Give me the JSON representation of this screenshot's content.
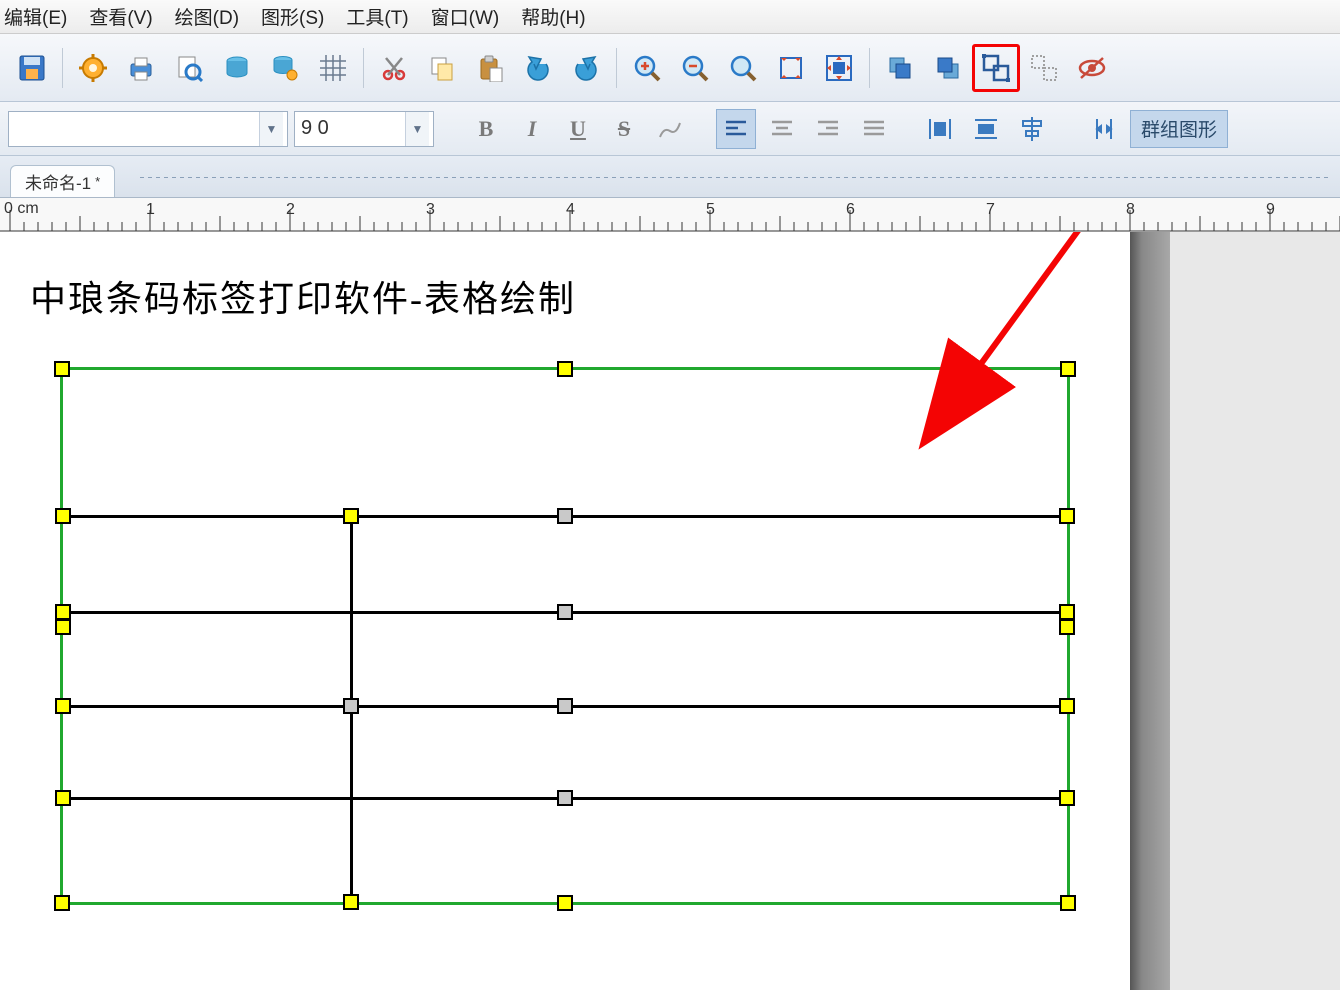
{
  "menu": {
    "edit": "编辑(E)",
    "view": "查看(V)",
    "draw": "绘图(D)",
    "shape": "图形(S)",
    "tool": "工具(T)",
    "window": "窗口(W)",
    "help": "帮助(H)"
  },
  "toolbar": {
    "font_size": "9 0",
    "group_label": "群组图形"
  },
  "tab": {
    "name": "未命名-1",
    "modified": "*"
  },
  "ruler": {
    "unit": "0 cm",
    "marks": [
      "1",
      "2",
      "3",
      "4",
      "5",
      "6",
      "7",
      "8",
      "9"
    ]
  },
  "canvas": {
    "title": "中琅条码标签打印软件-表格绘制"
  },
  "colors": {
    "selection_green": "#20a82e",
    "handle_yellow": "#ffff00",
    "handle_gray": "#c9c9c9",
    "highlight_red": "#f40404"
  },
  "icons": {
    "save": "save",
    "gear": "gear",
    "print": "print",
    "preview": "preview",
    "db1": "database",
    "db2": "database-alt",
    "grid": "grid",
    "cut": "cut",
    "copy": "copy",
    "paste": "paste",
    "undo": "undo",
    "redo": "redo",
    "zoomin": "zoom-in",
    "zoomout": "zoom-out",
    "zoom": "zoom",
    "fit": "fit",
    "fitwin": "fitwindow",
    "front": "bring-front",
    "back": "send-back",
    "group": "group",
    "ungroup": "ungroup",
    "eye": "eye-off"
  }
}
